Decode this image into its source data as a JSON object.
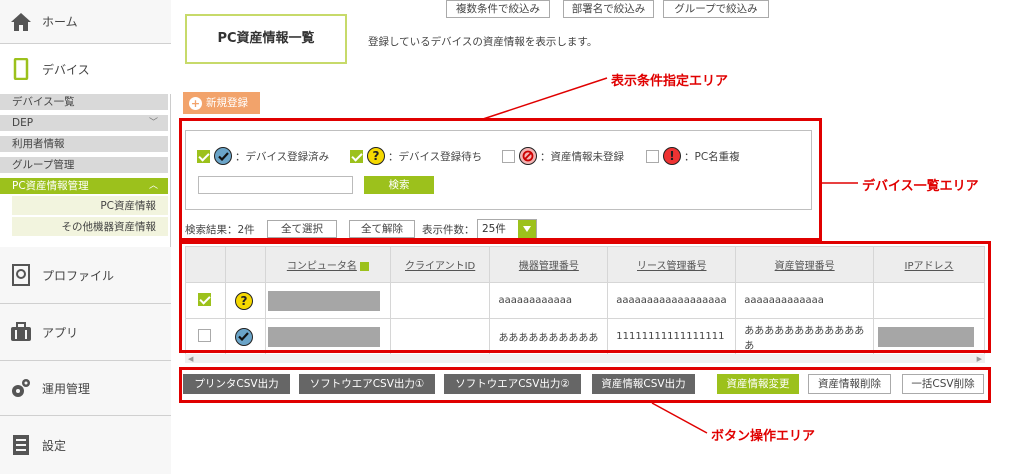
{
  "sidebar": {
    "home": "ホーム",
    "device": "デバイス",
    "subs": [
      {
        "label": "デバイス一覧"
      },
      {
        "label": "DEP"
      },
      {
        "label": "利用者情報"
      },
      {
        "label": "グループ管理"
      },
      {
        "label": "PC資産情報管理"
      }
    ],
    "subsubs": [
      "PC資産情報",
      "その他機器資産情報"
    ],
    "profile": "プロファイル",
    "app": "アプリ",
    "ops": "運用管理",
    "settings": "設定"
  },
  "header": {
    "title": "PC資産情報一覧",
    "description": "登録しているデバイスの資産情報を表示します。"
  },
  "new_button": "新規登録",
  "legend": [
    {
      "label": "：デバイス登録済み",
      "checked": true
    },
    {
      "label": "：デバイス登録待ち",
      "checked": true
    },
    {
      "label": "：資産情報未登録",
      "checked": false
    },
    {
      "label": "：PC名重複",
      "checked": false
    }
  ],
  "search": {
    "button": "検索",
    "multi_filter": "複数条件で絞込み",
    "dept_filter": "部署名で絞込み",
    "group_filter": "グループで絞込み",
    "value": ""
  },
  "results": {
    "count_label": "検索結果：2件",
    "select_all": "全て選択",
    "deselect_all": "全て解除",
    "per_page_label": "表示件数：",
    "per_page_value": "25件"
  },
  "table": {
    "headers": [
      "コンピュータ名",
      "クライアントID",
      "機器管理番号",
      "リース管理番号",
      "資産管理番号",
      "IPアドレス"
    ],
    "rows": [
      {
        "checked": true,
        "status": "?",
        "client_id": "",
        "device_no": "aaaaaaaaaaaa",
        "lease_no": "aaaaaaaaaaaaaaaaaa",
        "asset_no": "aaaaaaaaaaaaa",
        "ip": ""
      },
      {
        "checked": false,
        "status": "check",
        "client_id": "",
        "device_no": "ああああああああああ",
        "lease_no": "11111111111111111",
        "asset_no": "あああああああああああああ",
        "ip": ""
      }
    ]
  },
  "buttons": {
    "printer_csv": "プリンタCSV出力",
    "software_csv1": "ソフトウエアCSV出力①",
    "software_csv2": "ソフトウエアCSV出力②",
    "asset_csv": "資産情報CSV出力",
    "asset_change": "資産情報変更",
    "asset_delete": "資産情報削除",
    "bulk_csv_delete": "一括CSV削除"
  },
  "annotations": {
    "filter_area": "表示条件指定エリア",
    "list_area": "デバイス一覧エリア",
    "button_area": "ボタン操作エリア"
  },
  "colors": {
    "accent_green": "#9cc11c",
    "annotation_red": "#e00000",
    "new_button_orange": "#f2a36b"
  }
}
